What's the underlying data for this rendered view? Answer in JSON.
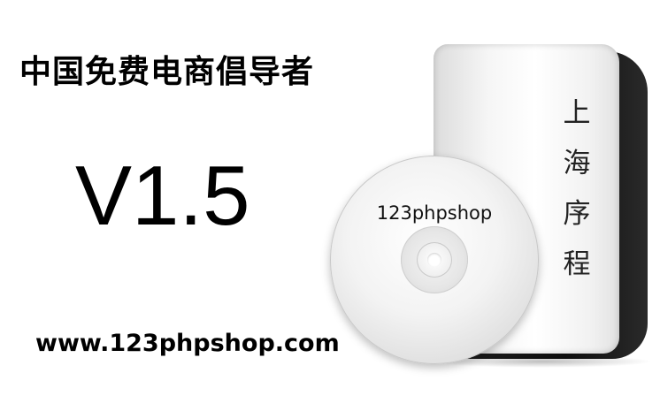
{
  "headline": "中国免费电商倡导者",
  "version": "V1.5",
  "website": "www.123phpshop.com",
  "product_box": {
    "vertical_text": "上\n海\n序\n程"
  },
  "disc": {
    "label": "123phpshop"
  }
}
